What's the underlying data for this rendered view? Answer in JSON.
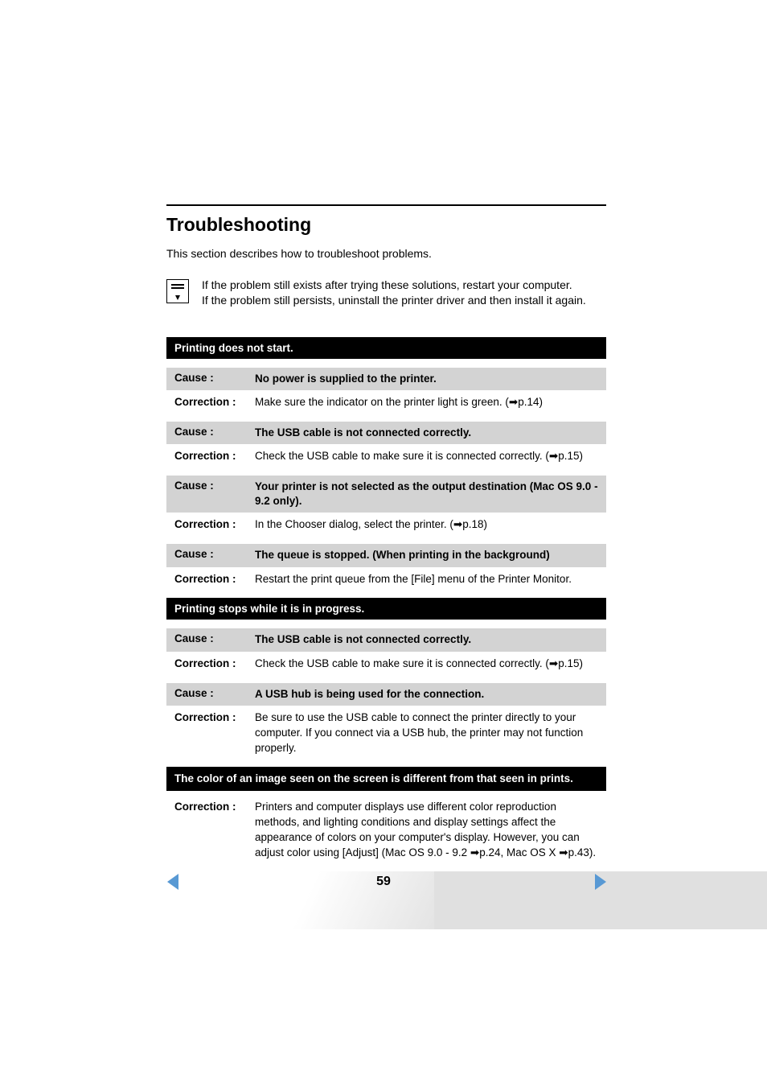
{
  "title": "Troubleshooting",
  "intro": "This section describes how to troubleshoot problems.",
  "note": {
    "line1": "If the problem still exists after trying these solutions, restart your computer.",
    "line2": "If the problem still persists, uninstall the printer driver and then install it again."
  },
  "sections": [
    {
      "heading": "Printing does not start.",
      "items": [
        {
          "cause_label": "Cause :",
          "cause": "No power is supplied to the printer.",
          "corr_label": "Correction :",
          "corr_prefix": "Make sure the indicator on the printer light is green. (",
          "page_ref": "p.14",
          "corr_suffix": ")"
        },
        {
          "cause_label": "Cause :",
          "cause": "The USB cable is not connected correctly.",
          "corr_label": "Correction :",
          "corr_prefix": "Check the USB cable to make sure it is connected correctly. (",
          "page_ref": "p.15",
          "corr_suffix": ")"
        },
        {
          "cause_label": "Cause :",
          "cause": "Your printer is not selected as the output destination (Mac OS 9.0 - 9.2 only).",
          "corr_label": "Correction :",
          "corr_prefix": "In the Chooser dialog, select the printer. (",
          "page_ref": "p.18",
          "corr_suffix": ")"
        },
        {
          "cause_label": "Cause :",
          "cause": "The queue is stopped. (When printing in the background)",
          "corr_label": "Correction :",
          "corr_plain": "Restart the print queue from the [File] menu of the Printer Monitor."
        }
      ]
    },
    {
      "heading": "Printing stops while it is in progress.",
      "items": [
        {
          "cause_label": "Cause :",
          "cause": "The USB cable is not connected correctly.",
          "corr_label": "Correction :",
          "corr_prefix": "Check the USB cable to make sure it is connected correctly. (",
          "page_ref": "p.15",
          "corr_suffix": ")"
        },
        {
          "cause_label": "Cause :",
          "cause": "A USB hub is being used for the connection.",
          "corr_label": "Correction :",
          "corr_plain": "Be sure to use the USB cable to connect the printer directly to your computer. If you connect via a USB hub, the printer may not function properly."
        }
      ]
    },
    {
      "heading": "The color of an image seen on the screen is different from that seen in prints.",
      "items": [
        {
          "corr_label": "Correction :",
          "corr_color": {
            "prefix": "Printers and computer displays use different color reproduction methods, and lighting conditions and display settings affect the appearance of colors on your computer's display. However, you can adjust color using [Adjust] (Mac OS 9.0 - 9.2 ",
            "ref1": "p.24",
            "mid": ", Mac OS X ",
            "ref2": "p.43",
            "suffix": ")."
          }
        }
      ]
    }
  ],
  "pager": {
    "page": "59"
  }
}
